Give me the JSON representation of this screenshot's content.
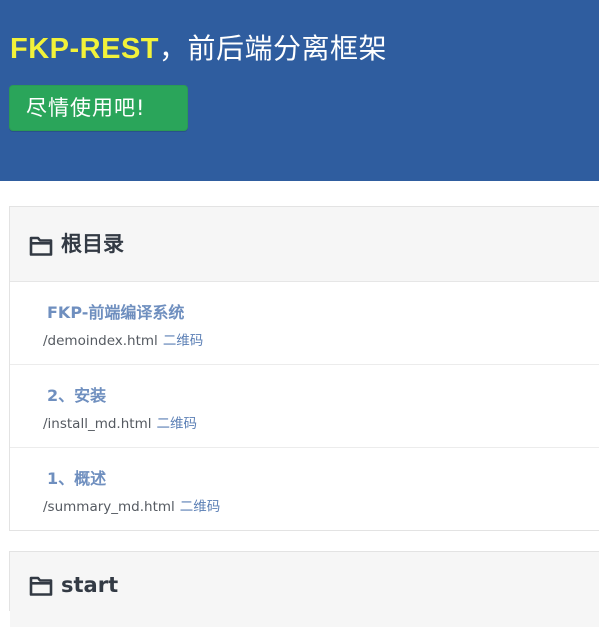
{
  "hero": {
    "brand": "FKP-REST",
    "tagline": "，前后端分离框架",
    "cta_label": "尽情使用吧!"
  },
  "sections": [
    {
      "title": "根目录",
      "icon": "folder-icon",
      "items": [
        {
          "title": "FKP-前端编译系统",
          "path": "/demoindex.html",
          "qr_label": "二维码"
        },
        {
          "title": "2、安装",
          "path": "/install_md.html",
          "qr_label": "二维码"
        },
        {
          "title": "1、概述",
          "path": "/summary_md.html",
          "qr_label": "二维码"
        }
      ]
    },
    {
      "title": "start",
      "icon": "folder-icon",
      "items": []
    }
  ],
  "colors": {
    "hero_bg": "#2f5d9f",
    "brand_yellow": "#f2f23a",
    "cta_green": "#2aa55a",
    "link_blue": "#5b7fb5",
    "item_title_blue": "#6f8fbf"
  }
}
